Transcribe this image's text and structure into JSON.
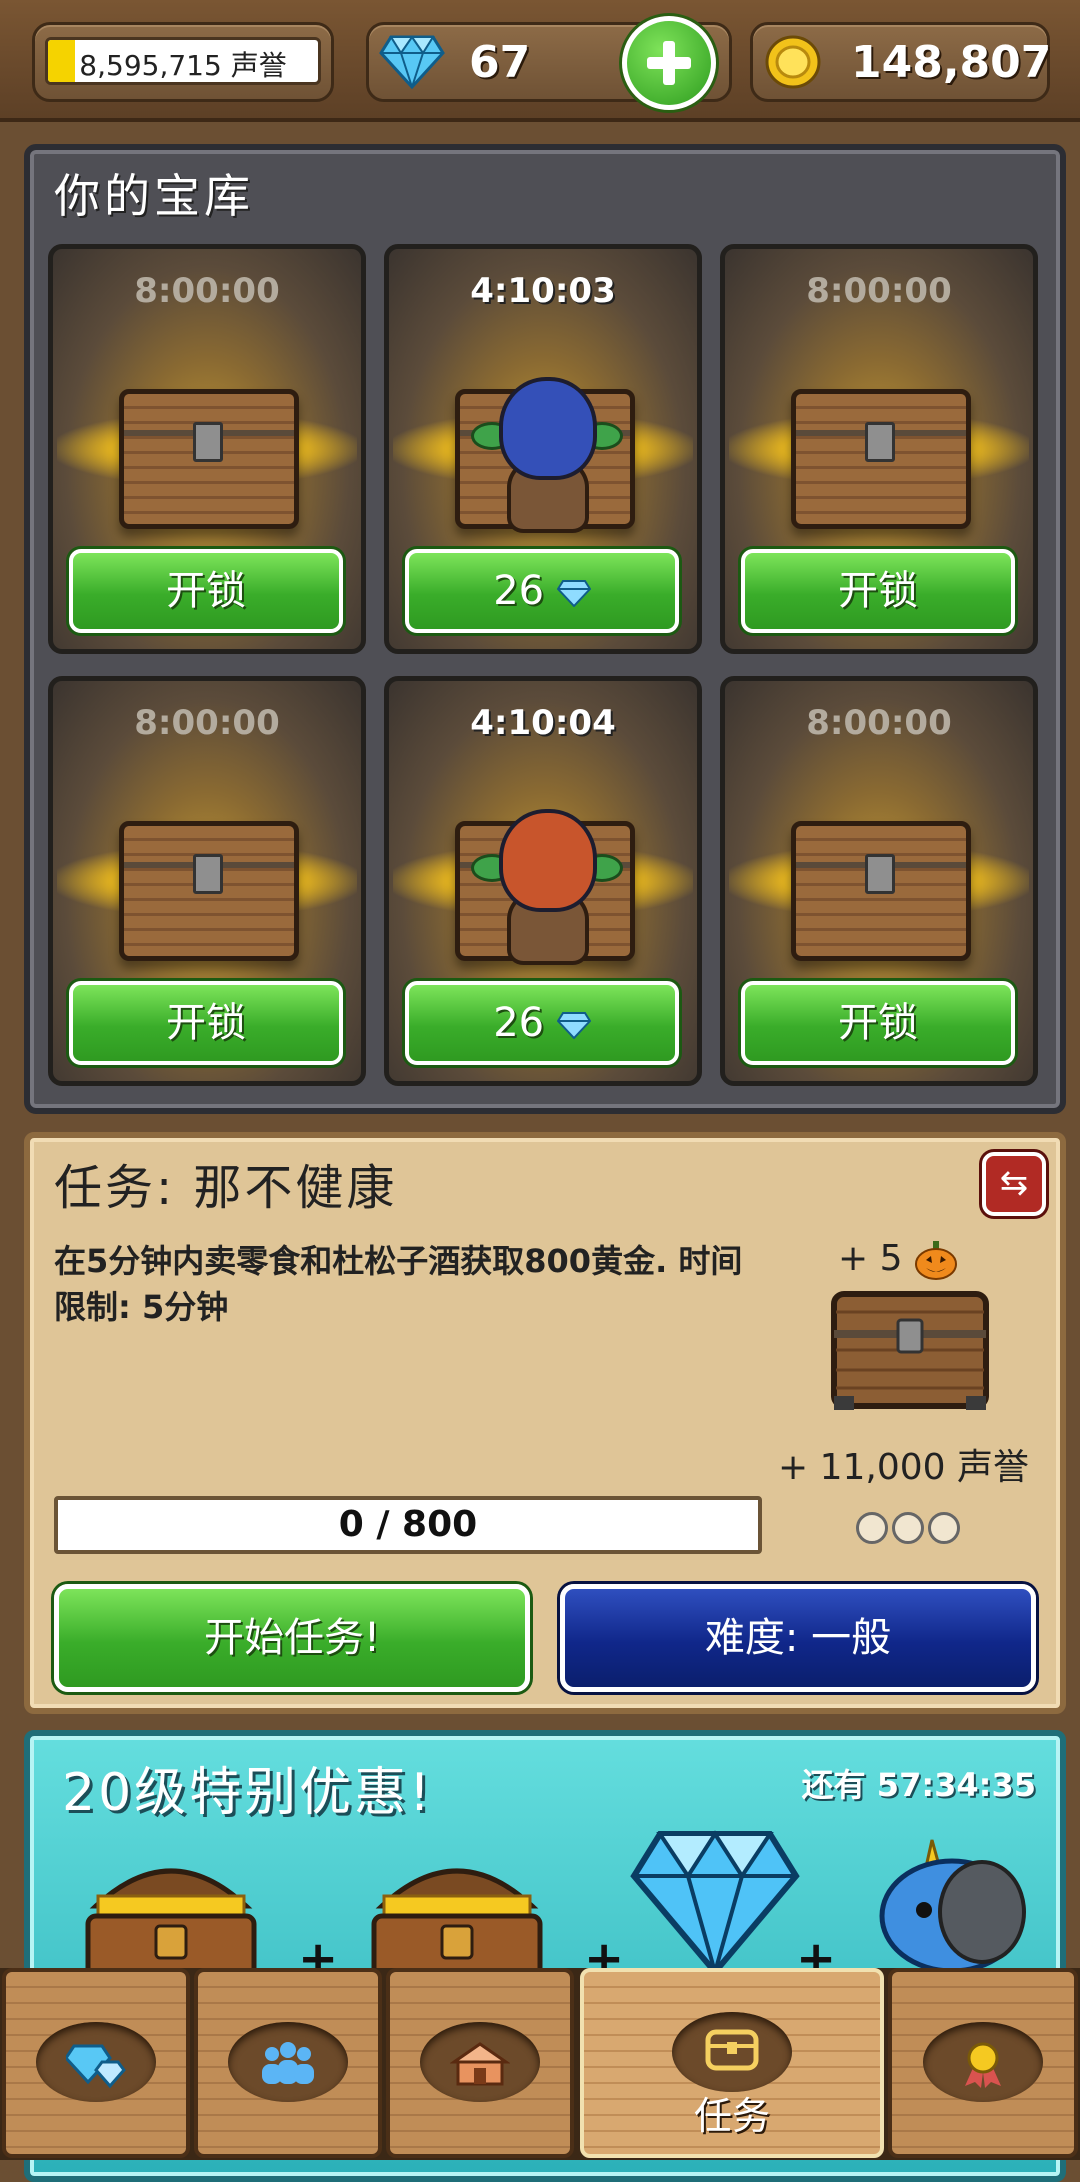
{
  "topbar": {
    "reputation_label": "8,595,715 声誉",
    "reputation_progress": 0.1,
    "gems": "67",
    "gold": "148,807"
  },
  "vault": {
    "title": "你的宝库",
    "slots": [
      {
        "timer": "8:00:00",
        "button": "开锁",
        "occupied": false
      },
      {
        "timer": "4:10:03",
        "button": "26",
        "occupied": true,
        "hood_color": "#3450b8"
      },
      {
        "timer": "8:00:00",
        "button": "开锁",
        "occupied": false
      },
      {
        "timer": "8:00:00",
        "button": "开锁",
        "occupied": false
      },
      {
        "timer": "4:10:04",
        "button": "26",
        "occupied": true,
        "hood_color": "#c8552c"
      },
      {
        "timer": "8:00:00",
        "button": "开锁",
        "occupied": false
      }
    ]
  },
  "quest": {
    "title": "任务:  那不健康",
    "description": "在5分钟内卖零食和杜松子酒获取800黄金. 时间限制: 5分钟",
    "reward_plus": "+ 5",
    "reward_reputation": "+ 11,000 声誉",
    "progress_text": "0 / 800",
    "progress_value": 0,
    "start_button": "开始任务!",
    "difficulty_button": "难度: 一般"
  },
  "offer": {
    "title": "20级特别优惠!",
    "timer": "还有 57:34:35",
    "items": [
      "treasure-chest",
      "treasure-chest",
      "diamond",
      "unicorn"
    ]
  },
  "nav": {
    "items": [
      {
        "icon": "gems-icon",
        "label": ""
      },
      {
        "icon": "people-icon",
        "label": ""
      },
      {
        "icon": "shop-icon",
        "label": ""
      },
      {
        "icon": "chest-icon",
        "label": "任务",
        "active": true
      },
      {
        "icon": "medal-icon",
        "label": ""
      }
    ]
  },
  "colors": {
    "accent_green": "#3aad2a",
    "accent_blue": "#10278a",
    "gold": "#f5d300"
  }
}
